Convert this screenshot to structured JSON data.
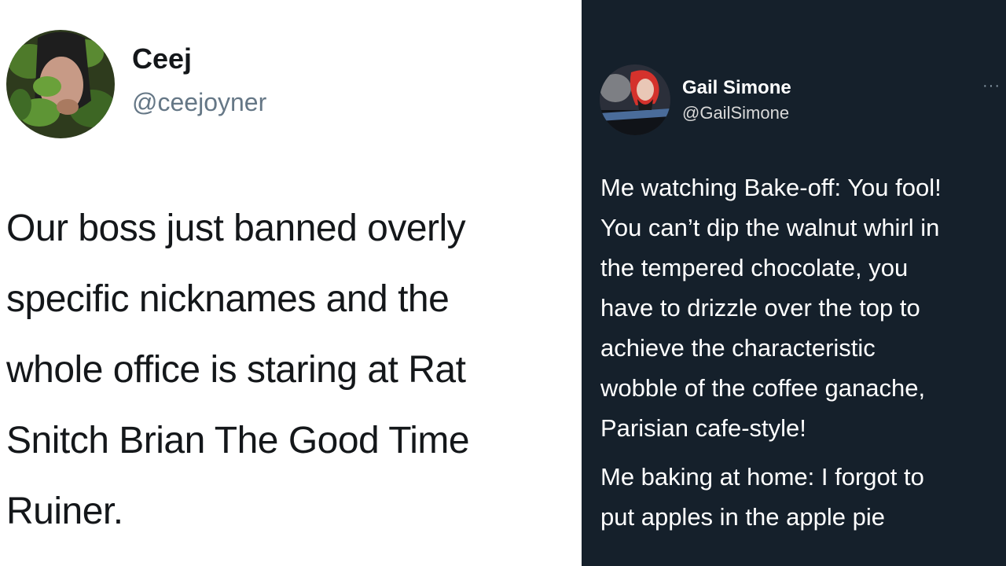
{
  "left_tweet": {
    "author_name": "Ceej",
    "author_handle": "@ceejoyner",
    "avatar_icon": "profile-photo-leaves",
    "body_lines": [
      "Our boss just banned overly",
      "specific nicknames and the",
      "whole office is staring at Rat",
      "Snitch Brian The Good Time",
      "Ruiner."
    ]
  },
  "right_tweet": {
    "author_name": "Gail Simone",
    "author_handle": "@GailSimone",
    "more_label": "···",
    "avatar_icon": "profile-photo-redhead",
    "paragraph1_lines": [
      "Me watching Bake-off: You fool!",
      "You can’t dip the walnut whirl in",
      "the tempered chocolate, you",
      "have to drizzle over the top to",
      "achieve the characteristic",
      "wobble of the coffee ganache,",
      "Parisian cafe-style!"
    ],
    "paragraph2_lines": [
      "Me baking at home:  I forgot to",
      "put apples in the apple pie"
    ]
  },
  "colors": {
    "light_bg": "#ffffff",
    "dark_bg": "#15202b",
    "handle_light": "#657786"
  }
}
